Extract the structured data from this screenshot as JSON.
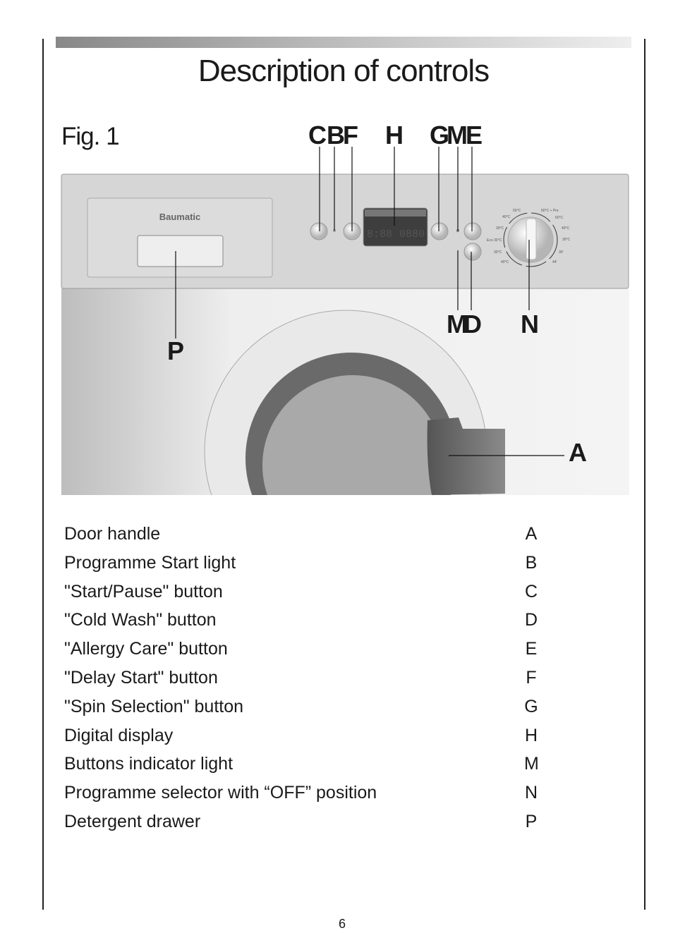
{
  "title": "Description of controls",
  "figure": {
    "label": "Fig. 1",
    "brand": "Baumatic",
    "callouts": [
      "C",
      "B",
      "F",
      "H",
      "G",
      "M",
      "E",
      "M",
      "D",
      "N",
      "P",
      "A"
    ],
    "display": {
      "left": "8:88",
      "right": "0880"
    },
    "dial_labels": [
      "50°C",
      "40°C",
      "30°C",
      "Eco 30°C",
      "30°C",
      "40°C",
      "60°C + Pre",
      "60°C",
      "40°C",
      "30°C",
      "30'",
      "44'"
    ]
  },
  "legend": [
    {
      "description": "Door handle",
      "letter": "A"
    },
    {
      "description": "Programme Start light",
      "letter": "B"
    },
    {
      "description": "\"Start/Pause\" button",
      "letter": "C"
    },
    {
      "description": "\"Cold Wash\" button",
      "letter": "D"
    },
    {
      "description": "\"Allergy Care\" button",
      "letter": "E"
    },
    {
      "description": "\"Delay Start\" button",
      "letter": "F"
    },
    {
      "description": "\"Spin Selection\" button",
      "letter": "G"
    },
    {
      "description": "Digital display",
      "letter": "H"
    },
    {
      "description": "Buttons indicator light",
      "letter": "M"
    },
    {
      "description": "Programme selector with “OFF” position",
      "letter": "N"
    },
    {
      "description": "Detergent drawer",
      "letter": "P"
    }
  ],
  "page_number": "6"
}
